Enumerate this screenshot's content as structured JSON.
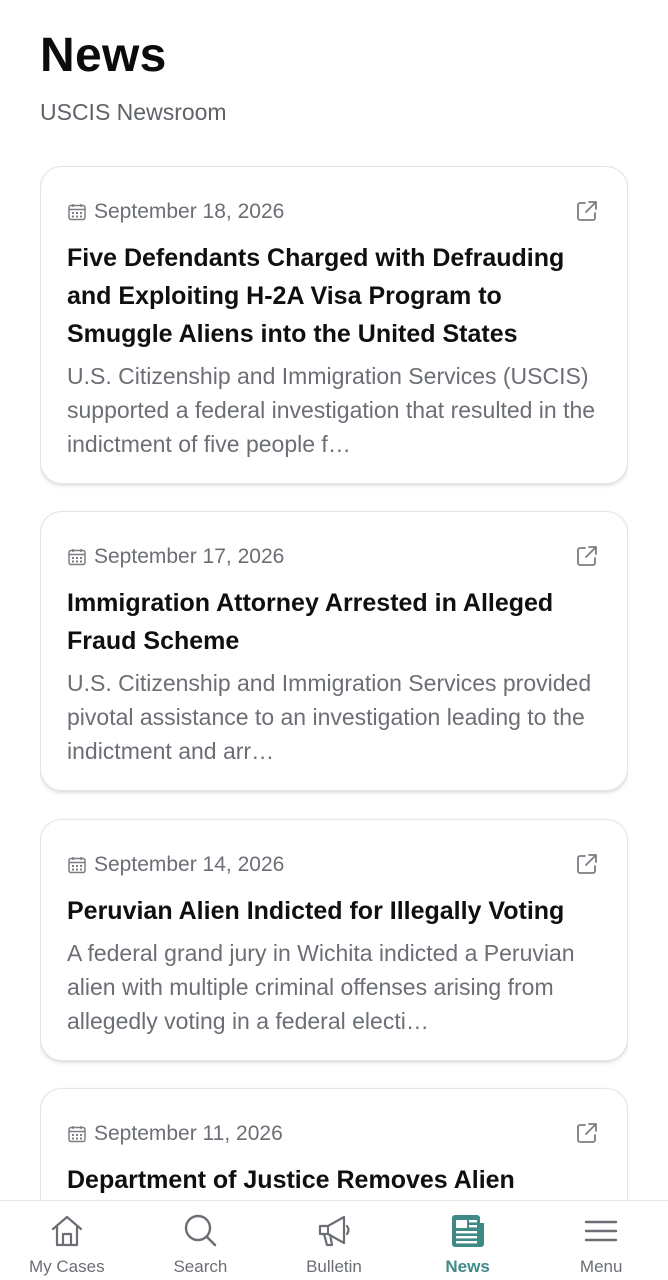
{
  "header": {
    "title": "News",
    "subtitle": "USCIS Newsroom"
  },
  "articles": [
    {
      "date": "September 18, 2026",
      "headline": "Five Defendants Charged with Defrauding and Exploiting H-2A Visa Program to Smuggle Aliens into the United States",
      "summary": "U.S. Citizenship and Immigration Services (USCIS) supported a federal investigation that resulted in the indictment of five people f…"
    },
    {
      "date": "September 17, 2026",
      "headline": "Immigration Attorney Arrested in Alleged Fraud Scheme",
      "summary": "U.S. Citizenship and Immigration Services provided pivotal assistance to an investigation leading to the indictment and arr…"
    },
    {
      "date": "September 14, 2026",
      "headline": "Peruvian Alien Indicted for Illegally Voting",
      "summary": "A federal grand jury in Wichita indicted a Peruvian alien with multiple criminal offenses arising from allegedly voting in a federal electi…"
    },
    {
      "date": "September 11, 2026",
      "headline": "Department of Justice Removes Alien",
      "summary": ""
    }
  ],
  "icons": {
    "date": "calendar-icon",
    "open": "external-link-icon"
  },
  "nav": {
    "active": "News",
    "items": [
      {
        "label": "My Cases",
        "icon": "house-icon"
      },
      {
        "label": "Search",
        "icon": "search-icon"
      },
      {
        "label": "Bulletin",
        "icon": "megaphone-icon"
      },
      {
        "label": "News",
        "icon": "newspaper-icon"
      },
      {
        "label": "Menu",
        "icon": "hamburger-menu-icon"
      }
    ]
  },
  "colors": {
    "accent": "#3f8a86",
    "muted_text": "#6b6f75",
    "card_border": "#e3e5e8"
  }
}
